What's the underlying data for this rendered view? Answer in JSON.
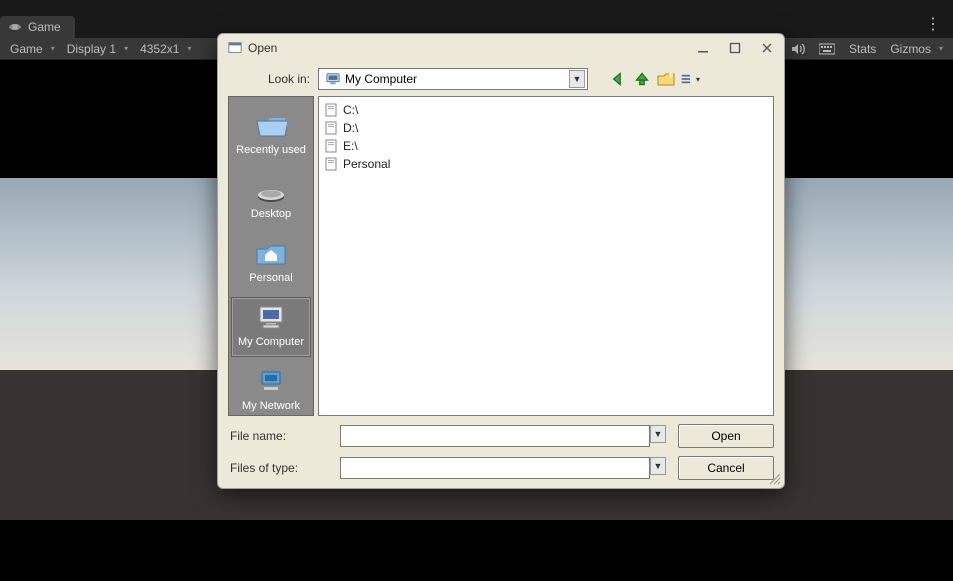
{
  "unity": {
    "game_tab": "Game",
    "game_dd": "Game",
    "display_dd": "Display 1",
    "resolution_dd": "4352x1",
    "stats": "Stats",
    "gizmos": "Gizmos"
  },
  "dialog": {
    "title": "Open",
    "lookin_label": "Look in:",
    "lookin_value": "My Computer",
    "places": [
      {
        "id": "recently-used",
        "label": "Recently used",
        "icon": "folder-open"
      },
      {
        "id": "desktop",
        "label": "Desktop",
        "icon": "desktop"
      },
      {
        "id": "personal",
        "label": "Personal",
        "icon": "home-folder"
      },
      {
        "id": "my-computer",
        "label": "My Computer",
        "icon": "computer",
        "selected": true
      },
      {
        "id": "my-network",
        "label": "My Network",
        "icon": "network"
      }
    ],
    "files": [
      {
        "label": "C:\\"
      },
      {
        "label": "D:\\"
      },
      {
        "label": "E:\\"
      },
      {
        "label": "Personal"
      }
    ],
    "filename_label": "File name:",
    "filetype_label": "Files of type:",
    "filename_value": "",
    "filetype_value": "",
    "open_btn": "Open",
    "cancel_btn": "Cancel"
  }
}
